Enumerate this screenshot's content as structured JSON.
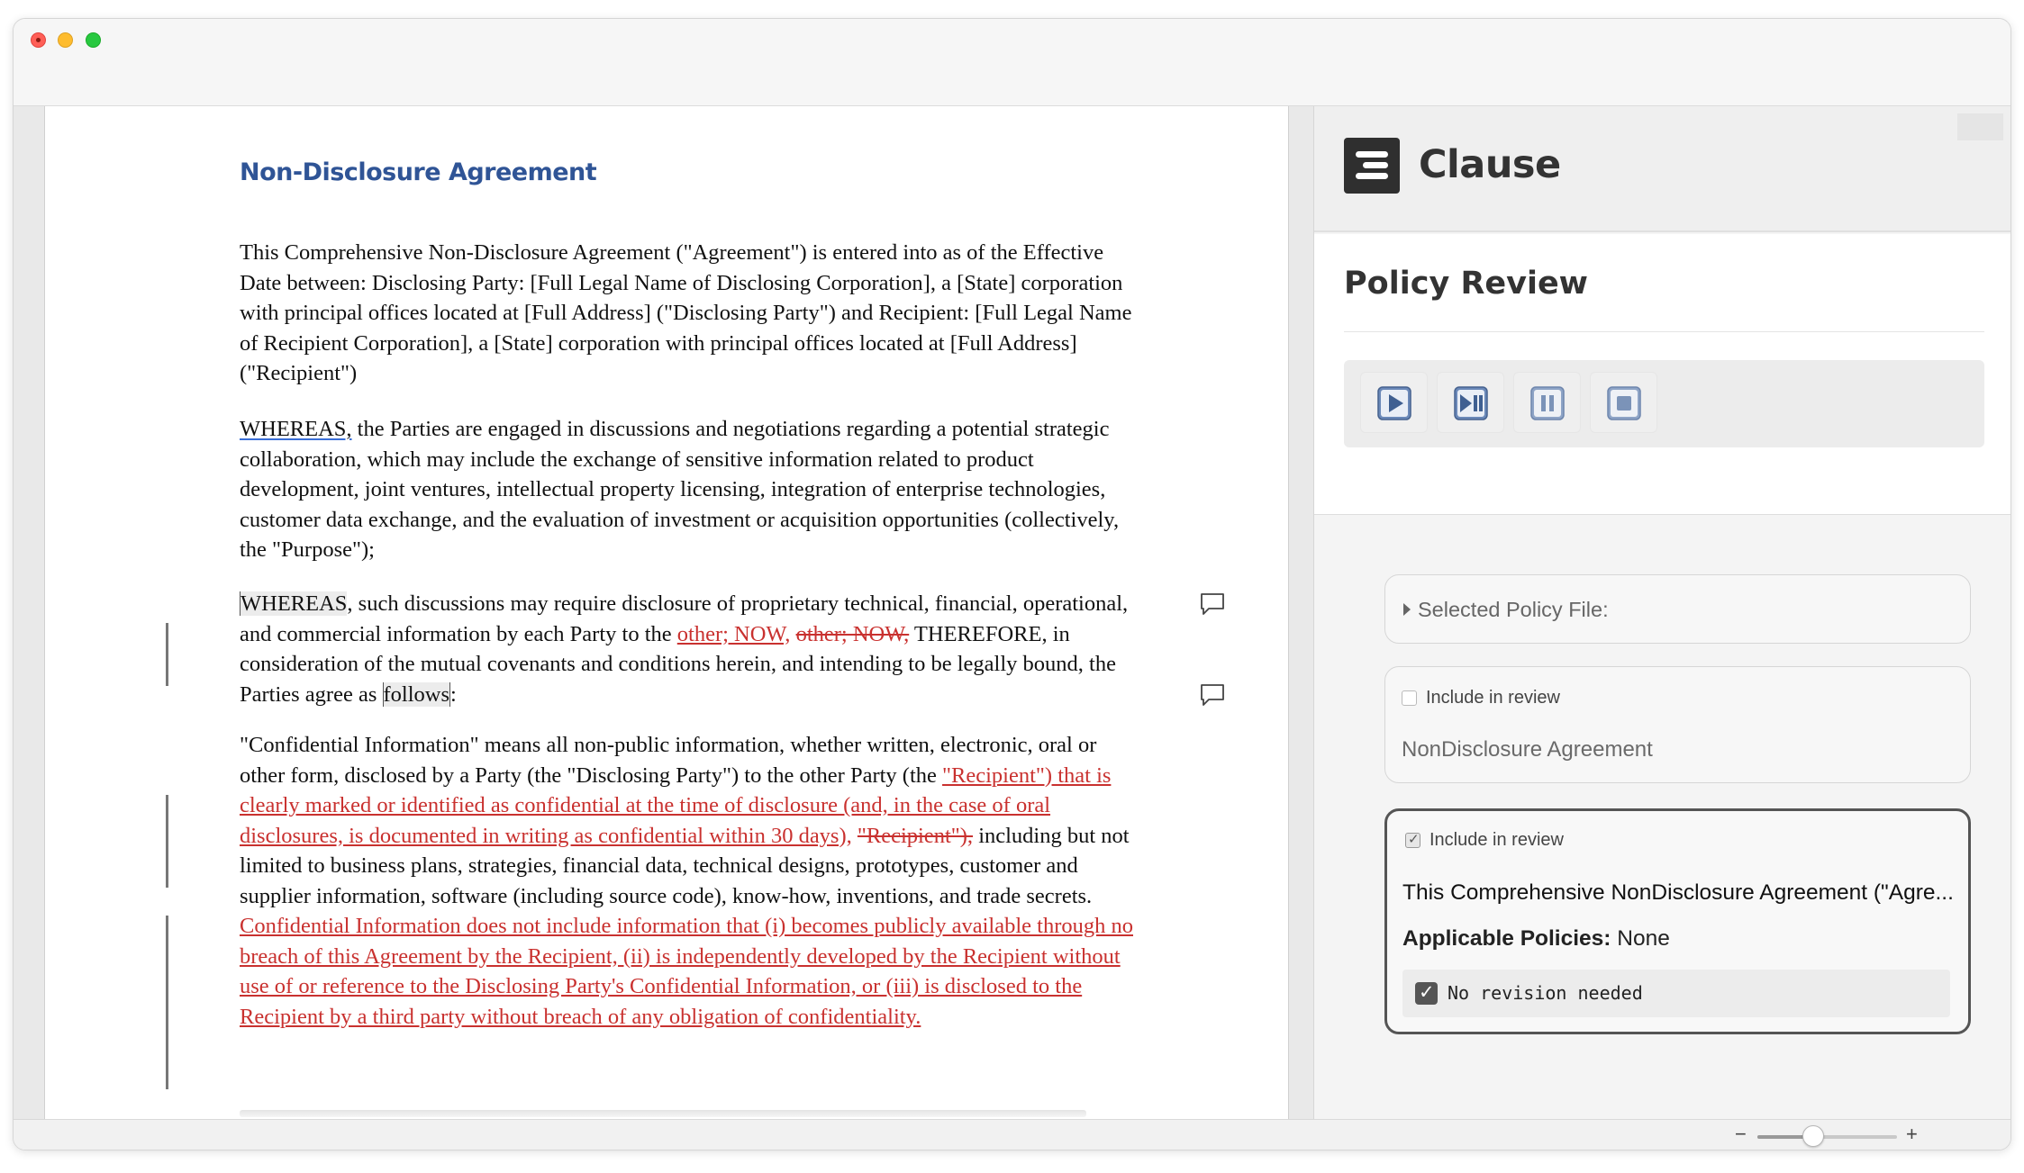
{
  "document": {
    "title": "Non-Disclosure Agreement",
    "p1": "This Comprehensive Non-Disclosure Agreement (\"Agreement\") is entered into as of the Effective Date between: Disclosing Party: [Full Legal Name of Disclosing Corporation], a [State] corporation with principal offices located at [Full Address] (\"Disclosing Party\") and Recipient: [Full Legal Name of Recipient Corporation], a [State] corporation with principal offices located at [Full Address] (\"Recipient\")",
    "p2_lead": "WHEREAS,",
    "p2_rest": " the Parties are engaged in discussions and negotiations regarding a potential strategic collaboration, which may include the exchange of sensitive information related to product development, joint ventures, intellectual property licensing, integration of enterprise technologies, customer data exchange, and the evaluation of investment or acquisition opportunities (collectively, the \"Purpose\");",
    "p3_lead": "WHEREAS",
    "p3_a": ", such discussions may require disclosure of proprietary technical, financial, operational, and commercial information by each Party to the ",
    "p3_ins": "other; NOW,",
    "p3_space": " ",
    "p3_del": "other; NOW,",
    "p3_b": " THEREFORE, in consideration of the mutual covenants and conditions herein, and intending to be legally bound, the Parties agree as ",
    "p3_follows": "follows",
    "p3_end": ":",
    "p4_a": "\"Confidential Information\" means all non-public information, whether written, electronic, oral or other form, disclosed by a Party (the \"Disclosing Party\") to the other Party (the ",
    "p4_ins1": "\"Recipient\") that is clearly marked or identified as confidential at the time of disclosure (and, in the case of oral disclosures, is documented in writing as confidential within 30 days),",
    "p4_space": " ",
    "p4_del": "\"Recipient\"),",
    "p4_b": " including but not limited to business plans, strategies, financial data, technical designs, prototypes, customer and supplier information, software (including source code), know-how, inventions, and trade secrets.",
    "p4_ins2": " Confidential Information does not include information that (i) becomes publicly available through no breach of this Agreement by the Recipient, (ii) is independently developed by the Recipient without use of or reference to the Disclosing Party's Confidential Information, or (iii) is disclosed to the Recipient by a third party without breach of any obligation of confidentiality."
  },
  "panel": {
    "brand": "Clause",
    "review_title": "Policy Review",
    "controls": [
      "play-icon",
      "play-pause-icon",
      "pause-icon",
      "stop-icon"
    ],
    "selected_file_label": "Selected Policy File:",
    "card1": {
      "include_label": "Include in review",
      "checked": false,
      "name": "NonDisclosure Agreement"
    },
    "card2": {
      "include_label": "Include in review",
      "checked": true,
      "clause": "This Comprehensive NonDisclosure Agreement (\"Agre...",
      "policies_label": "Applicable Policies:",
      "policies_value": " None",
      "revision_label": "No revision needed"
    }
  },
  "statusbar": {
    "zoom_minus": "−",
    "zoom_plus": "+",
    "zoom_level": 0.4
  },
  "colors": {
    "title_blue": "#2f5496",
    "track_change_red": "#c9312f",
    "accent_dark": "#555555"
  }
}
